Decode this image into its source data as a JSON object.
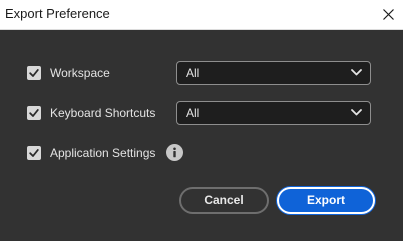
{
  "dialog": {
    "title": "Export Preference"
  },
  "rows": [
    {
      "label": "Workspace",
      "checked": true,
      "select_value": "All"
    },
    {
      "label": "Keyboard Shortcuts",
      "checked": true,
      "select_value": "All"
    },
    {
      "label": "Application Settings",
      "checked": true
    }
  ],
  "buttons": {
    "cancel_label": "Cancel",
    "export_label": "Export"
  },
  "colors": {
    "background": "#323232",
    "titlebar": "#ffffff",
    "accent": "#0f63d8",
    "checkbox": "#d8d8d8"
  },
  "icons": [
    "close-icon",
    "checkmark-icon",
    "chevron-down-icon",
    "info-icon"
  ]
}
